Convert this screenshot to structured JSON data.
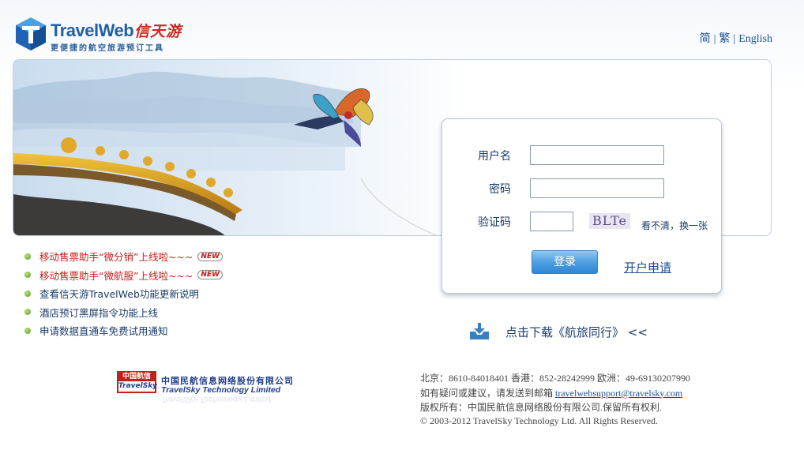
{
  "header": {
    "logo_title_travel": "Travel",
    "logo_title_web": "Web",
    "logo_cn": "信天游",
    "logo_slogan": "更便捷的航空旅游预订工具",
    "lang_simplified": "简",
    "lang_traditional": "繁",
    "lang_english": "English"
  },
  "login": {
    "username_label": "用户名",
    "password_label": "密码",
    "captcha_label": "验证码",
    "captcha_text": "BLTe",
    "refresh_label": "看不清，换一张",
    "submit_label": "登录",
    "register_label": "开户申请",
    "username_value": "",
    "password_value": "",
    "captcha_value": ""
  },
  "news": {
    "items": [
      {
        "label": "移动售票助手“微分销”上线啦~~~",
        "is_new": true
      },
      {
        "label": "移动售票助手“微航服”上线啦~~~",
        "is_new": true
      },
      {
        "label": "查看信天游TravelWeb功能更新说明",
        "is_new": false
      },
      {
        "label": "酒店预订黑屏指令功能上线",
        "is_new": false
      },
      {
        "label": "申请数据直通车免费试用通知",
        "is_new": false
      }
    ],
    "new_badge": "NEW"
  },
  "download": {
    "label": "点击下载《航旅同行》 <<"
  },
  "footer": {
    "badge_top": "中国航信",
    "badge_bottom": "TravelSky",
    "company_cn": "中国民航信息网络股份有限公司",
    "company_en": "TravelSky Technology Limited",
    "phones": "北京：8610-84018401 香港：852-28242999 欧洲：49-69130207990",
    "contact_prefix": "如有疑问或建议，请发送到邮箱 ",
    "contact_email": "travelwebsupport@travelsky.com",
    "rights_cn": "版权所有：中国民航信息网络股份有限公司.保留所有权利.",
    "copyright": "© 2003-2012 TravelSky Technology Ltd. All Rights Reserved."
  },
  "colors": {
    "brand_blue": "#1f5fa8",
    "brand_red": "#d0281e",
    "button_blue": "#4f9fe2",
    "text_dark": "#1b3c68"
  },
  "icons": [
    "cube-logo-icon",
    "bullet-dot-icon",
    "download-tray-icon"
  ]
}
